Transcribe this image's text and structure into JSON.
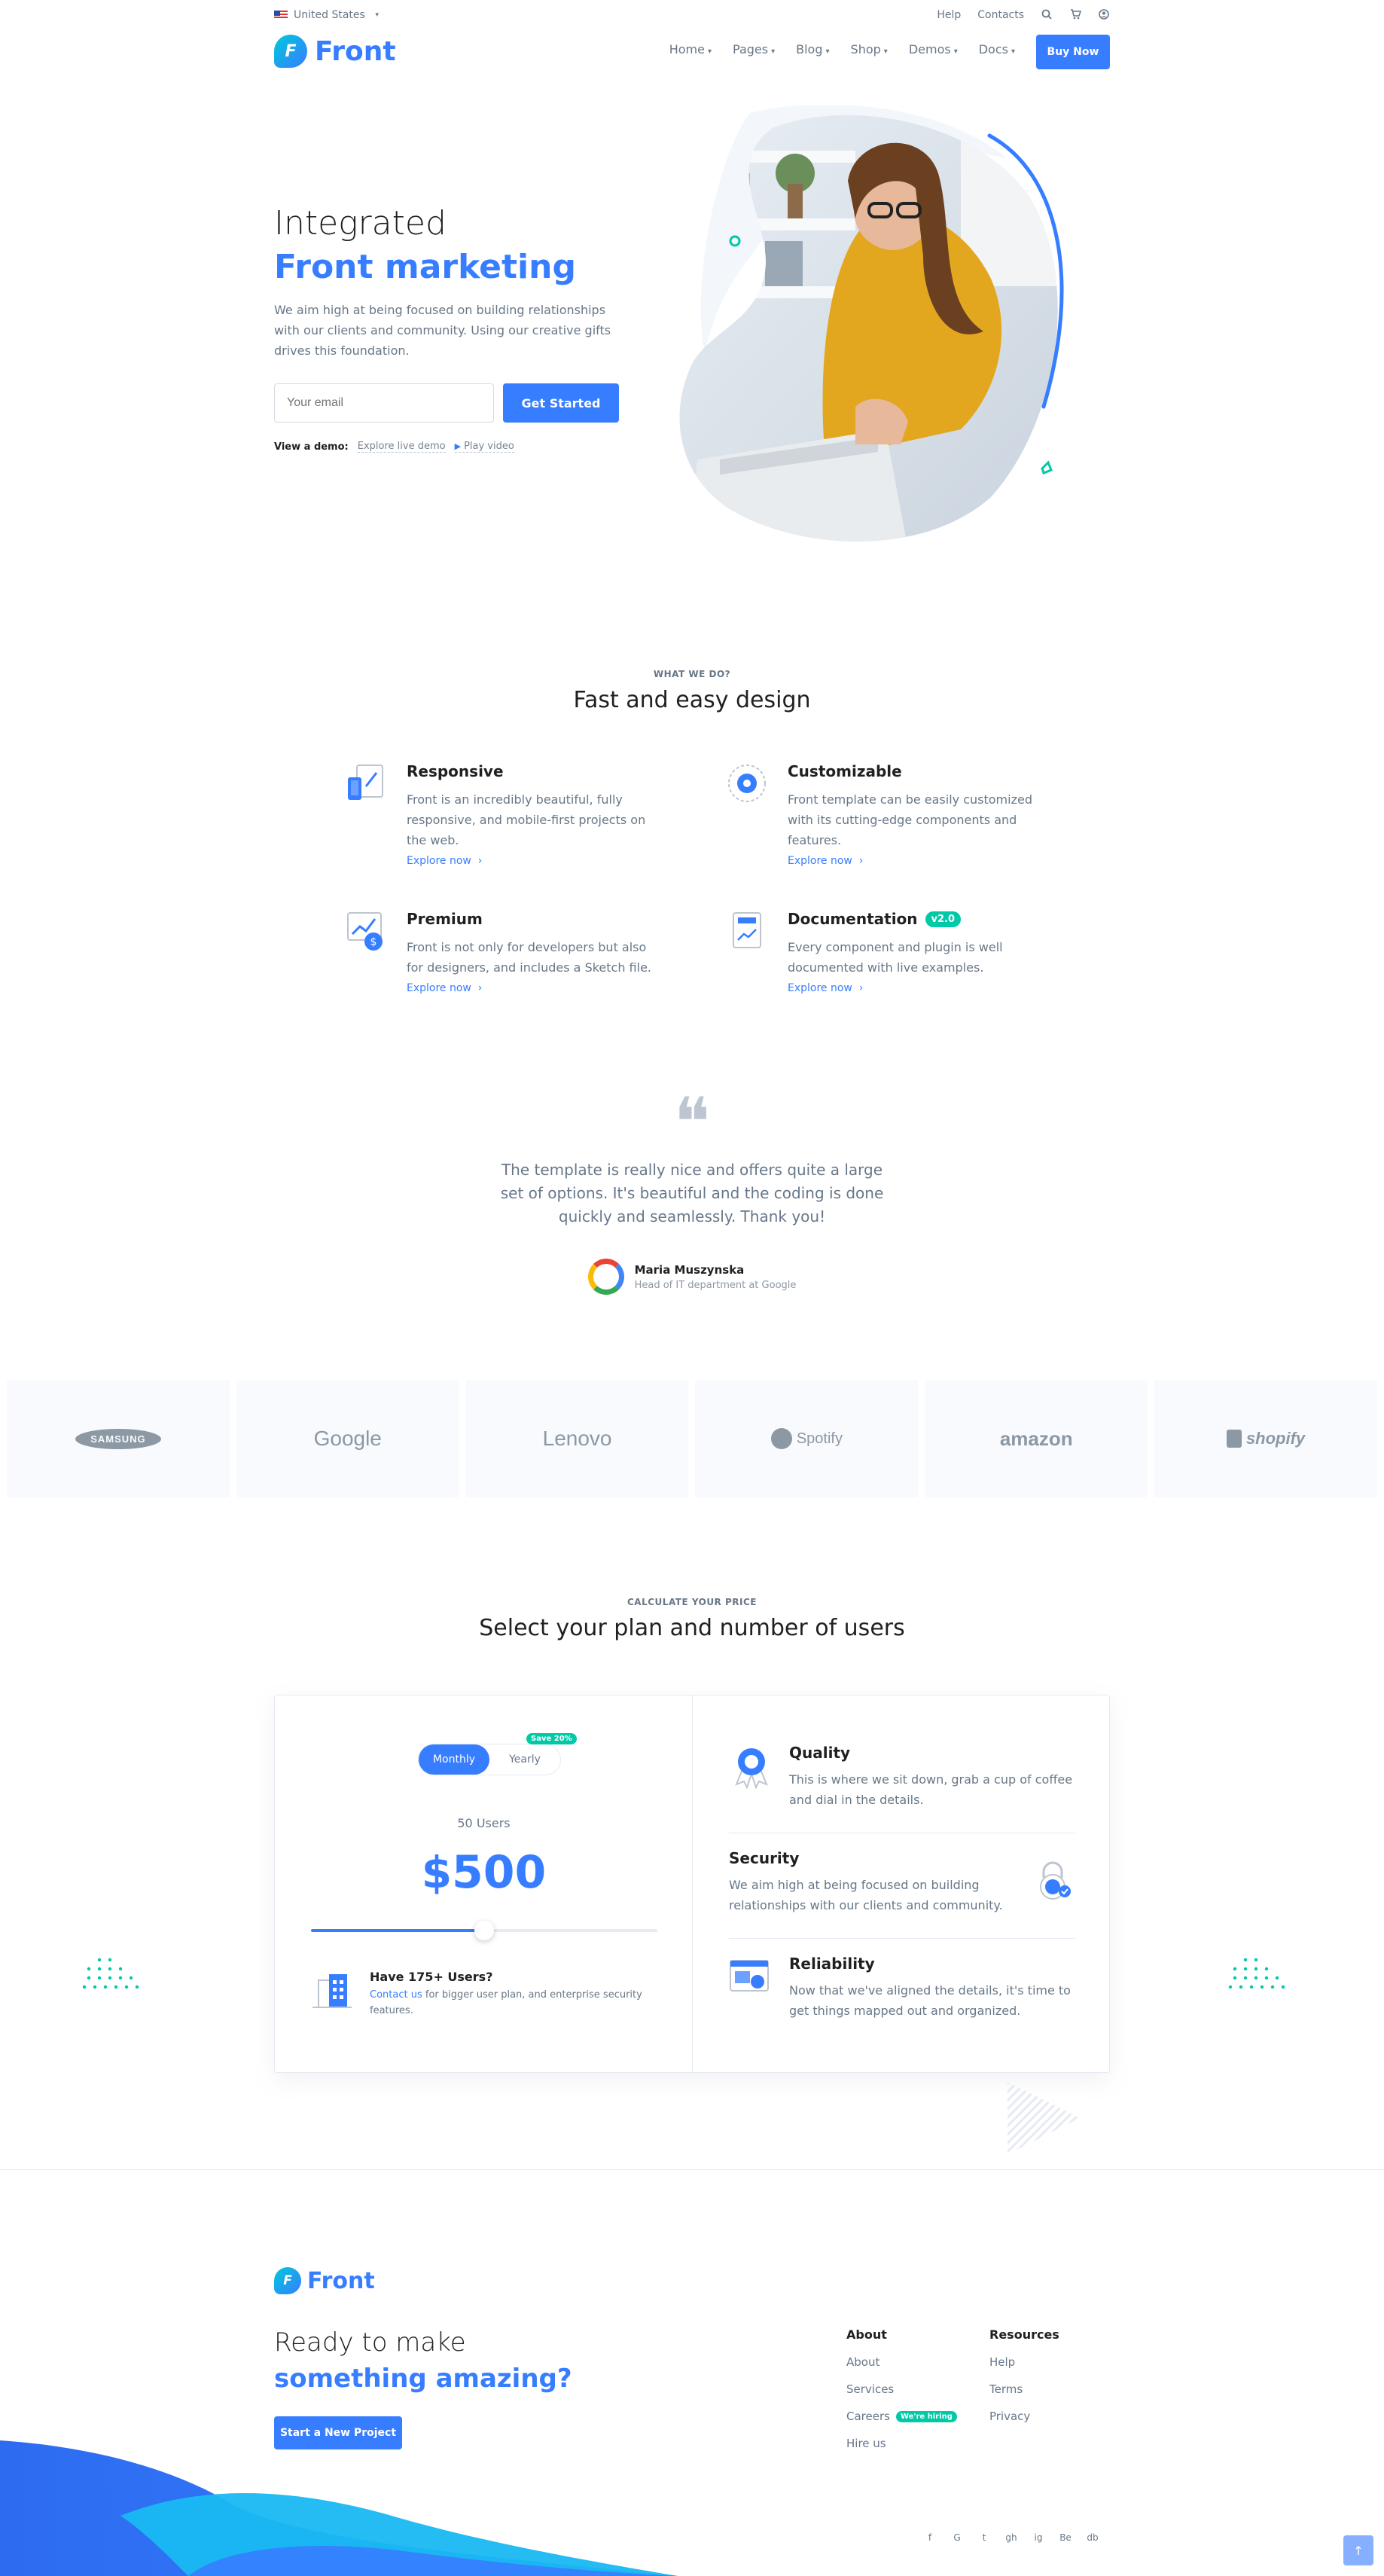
{
  "topbar": {
    "region": "United States",
    "links": [
      "Help",
      "Contacts"
    ]
  },
  "nav": {
    "logo": "Front",
    "logo_letter": "F",
    "menu": [
      "Home",
      "Pages",
      "Blog",
      "Shop",
      "Demos",
      "Docs"
    ],
    "buy": "Buy Now"
  },
  "hero": {
    "title_line1": "Integrated",
    "title_line2": "Front marketing",
    "description": "We aim high at being focused on building relationships with our clients and community. Using our creative gifts drives this foundation.",
    "email_placeholder": "Your email",
    "cta": "Get Started",
    "demo_label": "View a demo:",
    "demo_link": "Explore live demo",
    "video_link": "Play video"
  },
  "features": {
    "eyebrow": "WHAT WE DO?",
    "title": "Fast and easy design",
    "items": [
      {
        "title": "Responsive",
        "text": "Front is an incredibly beautiful, fully responsive, and mobile-first projects on the web.",
        "link": "Explore now"
      },
      {
        "title": "Customizable",
        "text": "Front template can be easily customized with its cutting-edge components and features.",
        "link": "Explore now"
      },
      {
        "title": "Premium",
        "text": "Front is not only for developers but also for designers, and includes a Sketch file.",
        "link": "Explore now"
      },
      {
        "title": "Documentation",
        "badge": "v2.0",
        "text": "Every component and plugin is well documented with live examples.",
        "link": "Explore now"
      }
    ]
  },
  "testimonial": {
    "quote": "The template is really nice and offers quite a large set of options. It's beautiful and the coding is done quickly and seamlessly. Thank you!",
    "name": "Maria Muszynska",
    "role": "Head of IT department at Google"
  },
  "clients": [
    "SAMSUNG",
    "Google",
    "Lenovo",
    "Spotify",
    "amazon",
    "shopify"
  ],
  "pricing": {
    "eyebrow": "CALCULATE YOUR PRICE",
    "title": "Select your plan and number of users",
    "toggle_monthly": "Monthly",
    "toggle_yearly": "Yearly",
    "save_badge": "Save 20%",
    "users": "50 Users",
    "currency": "$",
    "amount": "500",
    "slider_fraction": 0.5,
    "more_title": "Have 175+ Users?",
    "more_link": "Contact us",
    "more_text": " for bigger user plan, and enterprise security features.",
    "benefits": [
      {
        "title": "Quality",
        "text": "This is where we sit down, grab a cup of coffee and dial in the details."
      },
      {
        "title": "Security",
        "text": "We aim high at being focused on building relationships with our clients and community."
      },
      {
        "title": "Reliability",
        "text": "Now that we've aligned the details, it's time to get things mapped out and organized."
      }
    ]
  },
  "footer": {
    "logo": "Front",
    "title_line1": "Ready to make",
    "title_line2": "something amazing?",
    "cta": "Start a New Project",
    "about_title": "About",
    "about_links": [
      "About",
      "Services",
      "Careers",
      "Hire us"
    ],
    "hiring_badge": "We're hiring",
    "resources_title": "Resources",
    "resources_links": [
      "Help",
      "Terms",
      "Privacy"
    ],
    "social": [
      "f",
      "G",
      "t",
      "gh",
      "ig",
      "Be",
      "db"
    ]
  },
  "colors": {
    "primary": "#377dff",
    "teal": "#00c9a7",
    "cyan": "#00c9db"
  }
}
